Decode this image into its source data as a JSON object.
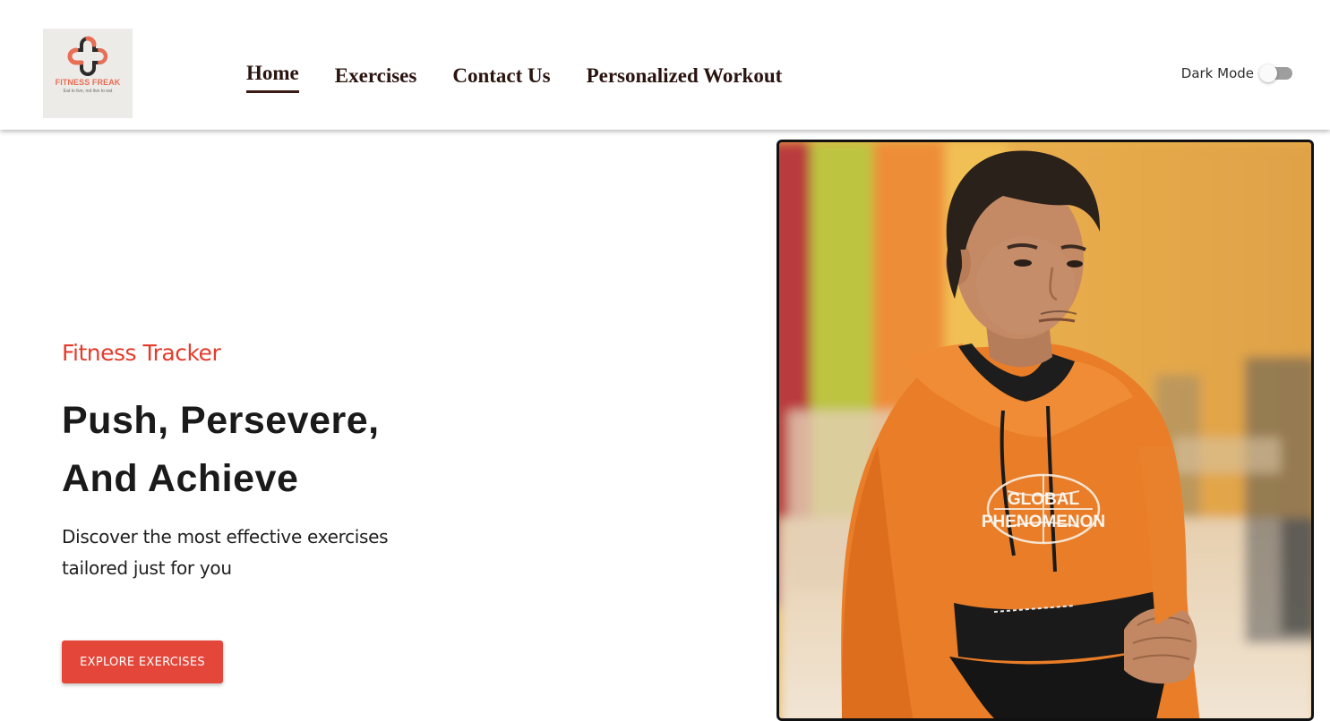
{
  "brand": {
    "name": "FITNESS FREAK",
    "tagline": "Eat to live, not live to eat",
    "colors": {
      "logo_accent": "#ea6d55",
      "logo_dark": "#2b2b2b",
      "logo_bg": "#ecebe7"
    }
  },
  "nav": {
    "items": [
      {
        "label": "Home",
        "active": true
      },
      {
        "label": "Exercises",
        "active": false
      },
      {
        "label": "Contact Us",
        "active": false
      },
      {
        "label": "Personalized Workout",
        "active": false
      }
    ]
  },
  "dark_mode": {
    "label": "Dark Mode",
    "enabled": false
  },
  "hero": {
    "kicker": "Fitness Tracker",
    "title_line1": "Push, Persevere,",
    "title_line2": "And Achieve",
    "description_line1": "Discover the most effective exercises",
    "description_line2": "tailored just for you",
    "cta_label": "EXPLORE EXERCISES",
    "accent_color": "#e33c2c",
    "button_color": "#e5463a"
  },
  "photo": {
    "subject": "young man in orange hoodie, gym background",
    "hoodie_print": "GLOBAL PHENOMENON"
  }
}
